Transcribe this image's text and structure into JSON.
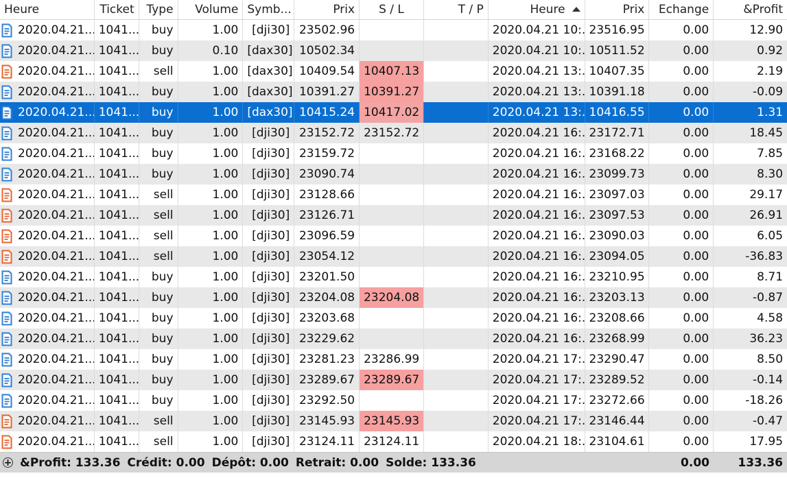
{
  "header": {
    "columns": [
      "Heure",
      "Ticket",
      "Type",
      "Volume",
      "Symb...",
      "Prix",
      "S / L",
      "T / P",
      "Heure",
      "Prix",
      "Echange",
      "&Profit"
    ],
    "sorted_column_index": 8,
    "sort_direction": "ascending"
  },
  "colors": {
    "selection": "#0a6fd1",
    "sl_highlight": "#f6a0a0",
    "buy_icon": "#2f7fd6",
    "sell_icon": "#e8632f",
    "alt_row": "#e8e8e8"
  },
  "rows": [
    {
      "open_time": "2020.04.21...",
      "ticket": "1041...",
      "type": "buy",
      "volume": "1.00",
      "symbol": "[dji30]",
      "open_price": "23502.96",
      "sl": "",
      "tp": "",
      "close_time": "2020.04.21 10:...",
      "close_price": "23516.95",
      "swap": "0.00",
      "profit": "12.90",
      "sl_highlight": false,
      "icon": "buy-order-icon"
    },
    {
      "open_time": "2020.04.21...",
      "ticket": "1041...",
      "type": "buy",
      "volume": "0.10",
      "symbol": "[dax30]",
      "open_price": "10502.34",
      "sl": "",
      "tp": "",
      "close_time": "2020.04.21 10:...",
      "close_price": "10511.52",
      "swap": "0.00",
      "profit": "0.92",
      "sl_highlight": false,
      "icon": "buy-order-icon"
    },
    {
      "open_time": "2020.04.21...",
      "ticket": "1041...",
      "type": "sell",
      "volume": "1.00",
      "symbol": "[dax30]",
      "open_price": "10409.54",
      "sl": "10407.13",
      "tp": "",
      "close_time": "2020.04.21 13:...",
      "close_price": "10407.35",
      "swap": "0.00",
      "profit": "2.19",
      "sl_highlight": true,
      "icon": "sell-order-icon"
    },
    {
      "open_time": "2020.04.21...",
      "ticket": "1041...",
      "type": "buy",
      "volume": "1.00",
      "symbol": "[dax30]",
      "open_price": "10391.27",
      "sl": "10391.27",
      "tp": "",
      "close_time": "2020.04.21 13:...",
      "close_price": "10391.18",
      "swap": "0.00",
      "profit": "-0.09",
      "sl_highlight": true,
      "icon": "buy-order-icon"
    },
    {
      "open_time": "2020.04.21...",
      "ticket": "1041...",
      "type": "buy",
      "volume": "1.00",
      "symbol": "[dax30]",
      "open_price": "10415.24",
      "sl": "10417.02",
      "tp": "",
      "close_time": "2020.04.21 13:...",
      "close_price": "10416.55",
      "swap": "0.00",
      "profit": "1.31",
      "sl_highlight": true,
      "icon": "buy-order-icon",
      "selected": true
    },
    {
      "open_time": "2020.04.21...",
      "ticket": "1041...",
      "type": "buy",
      "volume": "1.00",
      "symbol": "[dji30]",
      "open_price": "23152.72",
      "sl": "23152.72",
      "tp": "",
      "close_time": "2020.04.21 16:...",
      "close_price": "23172.71",
      "swap": "0.00",
      "profit": "18.45",
      "sl_highlight": false,
      "icon": "buy-order-icon"
    },
    {
      "open_time": "2020.04.21...",
      "ticket": "1041...",
      "type": "buy",
      "volume": "1.00",
      "symbol": "[dji30]",
      "open_price": "23159.72",
      "sl": "",
      "tp": "",
      "close_time": "2020.04.21 16:...",
      "close_price": "23168.22",
      "swap": "0.00",
      "profit": "7.85",
      "sl_highlight": false,
      "icon": "buy-order-icon"
    },
    {
      "open_time": "2020.04.21...",
      "ticket": "1041...",
      "type": "buy",
      "volume": "1.00",
      "symbol": "[dji30]",
      "open_price": "23090.74",
      "sl": "",
      "tp": "",
      "close_time": "2020.04.21 16:...",
      "close_price": "23099.73",
      "swap": "0.00",
      "profit": "8.30",
      "sl_highlight": false,
      "icon": "buy-order-icon"
    },
    {
      "open_time": "2020.04.21...",
      "ticket": "1041...",
      "type": "sell",
      "volume": "1.00",
      "symbol": "[dji30]",
      "open_price": "23128.66",
      "sl": "",
      "tp": "",
      "close_time": "2020.04.21 16:...",
      "close_price": "23097.03",
      "swap": "0.00",
      "profit": "29.17",
      "sl_highlight": false,
      "icon": "sell-order-icon"
    },
    {
      "open_time": "2020.04.21...",
      "ticket": "1041...",
      "type": "sell",
      "volume": "1.00",
      "symbol": "[dji30]",
      "open_price": "23126.71",
      "sl": "",
      "tp": "",
      "close_time": "2020.04.21 16:...",
      "close_price": "23097.53",
      "swap": "0.00",
      "profit": "26.91",
      "sl_highlight": false,
      "icon": "sell-order-icon"
    },
    {
      "open_time": "2020.04.21...",
      "ticket": "1041...",
      "type": "sell",
      "volume": "1.00",
      "symbol": "[dji30]",
      "open_price": "23096.59",
      "sl": "",
      "tp": "",
      "close_time": "2020.04.21 16:...",
      "close_price": "23090.03",
      "swap": "0.00",
      "profit": "6.05",
      "sl_highlight": false,
      "icon": "sell-order-icon"
    },
    {
      "open_time": "2020.04.21...",
      "ticket": "1041...",
      "type": "sell",
      "volume": "1.00",
      "symbol": "[dji30]",
      "open_price": "23054.12",
      "sl": "",
      "tp": "",
      "close_time": "2020.04.21 16:...",
      "close_price": "23094.05",
      "swap": "0.00",
      "profit": "-36.83",
      "sl_highlight": false,
      "icon": "sell-order-icon"
    },
    {
      "open_time": "2020.04.21...",
      "ticket": "1041...",
      "type": "buy",
      "volume": "1.00",
      "symbol": "[dji30]",
      "open_price": "23201.50",
      "sl": "",
      "tp": "",
      "close_time": "2020.04.21 16:...",
      "close_price": "23210.95",
      "swap": "0.00",
      "profit": "8.71",
      "sl_highlight": false,
      "icon": "buy-order-icon"
    },
    {
      "open_time": "2020.04.21...",
      "ticket": "1041...",
      "type": "buy",
      "volume": "1.00",
      "symbol": "[dji30]",
      "open_price": "23204.08",
      "sl": "23204.08",
      "tp": "",
      "close_time": "2020.04.21 16:...",
      "close_price": "23203.13",
      "swap": "0.00",
      "profit": "-0.87",
      "sl_highlight": true,
      "icon": "buy-order-icon"
    },
    {
      "open_time": "2020.04.21...",
      "ticket": "1041...",
      "type": "buy",
      "volume": "1.00",
      "symbol": "[dji30]",
      "open_price": "23203.68",
      "sl": "",
      "tp": "",
      "close_time": "2020.04.21 16:...",
      "close_price": "23208.66",
      "swap": "0.00",
      "profit": "4.58",
      "sl_highlight": false,
      "icon": "buy-order-icon"
    },
    {
      "open_time": "2020.04.21...",
      "ticket": "1041...",
      "type": "buy",
      "volume": "1.00",
      "symbol": "[dji30]",
      "open_price": "23229.62",
      "sl": "",
      "tp": "",
      "close_time": "2020.04.21 16:...",
      "close_price": "23268.99",
      "swap": "0.00",
      "profit": "36.23",
      "sl_highlight": false,
      "icon": "buy-order-icon"
    },
    {
      "open_time": "2020.04.21...",
      "ticket": "1041...",
      "type": "buy",
      "volume": "1.00",
      "symbol": "[dji30]",
      "open_price": "23281.23",
      "sl": "23286.99",
      "tp": "",
      "close_time": "2020.04.21 17:...",
      "close_price": "23290.47",
      "swap": "0.00",
      "profit": "8.50",
      "sl_highlight": false,
      "icon": "buy-order-icon"
    },
    {
      "open_time": "2020.04.21...",
      "ticket": "1041...",
      "type": "buy",
      "volume": "1.00",
      "symbol": "[dji30]",
      "open_price": "23289.67",
      "sl": "23289.67",
      "tp": "",
      "close_time": "2020.04.21 17:...",
      "close_price": "23289.52",
      "swap": "0.00",
      "profit": "-0.14",
      "sl_highlight": true,
      "icon": "buy-order-icon"
    },
    {
      "open_time": "2020.04.21...",
      "ticket": "1041...",
      "type": "buy",
      "volume": "1.00",
      "symbol": "[dji30]",
      "open_price": "23292.50",
      "sl": "",
      "tp": "",
      "close_time": "2020.04.21 17:...",
      "close_price": "23272.66",
      "swap": "0.00",
      "profit": "-18.26",
      "sl_highlight": false,
      "icon": "buy-order-icon"
    },
    {
      "open_time": "2020.04.21...",
      "ticket": "1041...",
      "type": "sell",
      "volume": "1.00",
      "symbol": "[dji30]",
      "open_price": "23145.93",
      "sl": "23145.93",
      "tp": "",
      "close_time": "2020.04.21 17:...",
      "close_price": "23146.44",
      "swap": "0.00",
      "profit": "-0.47",
      "sl_highlight": true,
      "icon": "sell-order-icon"
    },
    {
      "open_time": "2020.04.21...",
      "ticket": "1041...",
      "type": "sell",
      "volume": "1.00",
      "symbol": "[dji30]",
      "open_price": "23124.11",
      "sl": "23124.11",
      "tp": "",
      "close_time": "2020.04.21 18:...",
      "close_price": "23104.61",
      "swap": "0.00",
      "profit": "17.95",
      "sl_highlight": false,
      "icon": "sell-order-icon"
    }
  ],
  "footer": {
    "expand_icon": "plus-circle-icon",
    "profit_label": "&Profit: 133.36",
    "credit_label": "Crédit: 0.00",
    "deposit_label": "Dépôt: 0.00",
    "withdrawal_label": "Retrait: 0.00",
    "balance_label": "Solde: 133.36",
    "swap_total": "0.00",
    "profit_total": "133.36"
  }
}
